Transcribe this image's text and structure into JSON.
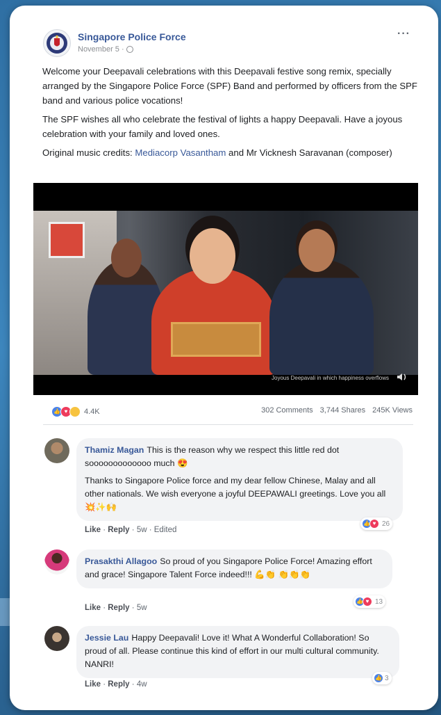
{
  "post": {
    "page_name": "Singapore Police Force",
    "date": "November 5 ·",
    "more": "···",
    "paragraphs": [
      "Welcome your Deepavali celebrations with this Deepavali festive song remix, specially arranged by the Singapore Police Force (SPF) Band and performed by officers from the SPF band and various police vocations!",
      "The SPF wishes all who celebrate the festival of lights a happy Deepavali. Have a joyous celebration with your family and loved ones."
    ],
    "credits_prefix": "Original music credits: ",
    "credits_link": "Mediacorp Vasantham",
    "credits_suffix": " and Mr Vicknesh Saravanan (composer)",
    "video_caption": "Joyous Deepavali in which happiness overflows"
  },
  "stats": {
    "reactions_count": "4.4K",
    "comments": "302 Comments",
    "shares": "3,744 Shares",
    "views": "245K Views"
  },
  "comments": [
    {
      "name": "Thamiz Magan",
      "line1": "This is the reason why we respect this little red dot sooooooooooooo much 😍",
      "line2": "Thanks to Singapore Police force and my dear fellow Chinese, Malay and all other nationals. We wish everyone a joyful DEEPAWALI greetings. Love you all 💥✨🙌",
      "like": "Like",
      "reply": "Reply",
      "time": "5w",
      "edited": "Edited",
      "reaction_count": "26"
    },
    {
      "name": "Prasakthi Allagoo",
      "text": "So proud of you Singapore Police Force! Amazing effort and grace! Singapore Talent Force indeed!!! 💪👏 👏👏👏",
      "like": "Like",
      "reply": "Reply",
      "time": "5w",
      "reaction_count": "13"
    },
    {
      "name": "Jessie Lau",
      "text": "Happy Deepavali! Love it! What A Wonderful Collaboration! So proud of all. Please continue this kind of effort in our multi cultural community. NANRI!",
      "like": "Like",
      "reply": "Reply",
      "time": "4w",
      "reaction_count": "3"
    }
  ],
  "colors": {
    "link": "#385898",
    "like_blue": "#4a82e8",
    "love_red": "#ee3b5c",
    "wow_yellow": "#f7c33f"
  },
  "icons": [
    "spf-logo-icon",
    "globe-icon",
    "more-icon",
    "speaker-icon",
    "like-reaction-icon",
    "love-reaction-icon",
    "wow-reaction-icon"
  ]
}
